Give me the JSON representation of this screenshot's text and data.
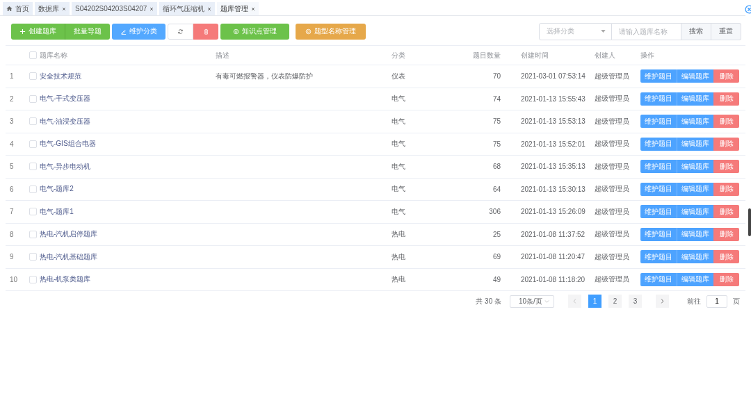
{
  "tabs": [
    {
      "label": "首页",
      "kind": "home",
      "selected": false
    },
    {
      "label": "数据库",
      "kind": "closable",
      "selected": false
    },
    {
      "label": "S04202S04203S04207",
      "kind": "closable",
      "selected": false
    },
    {
      "label": "循环气压缩机",
      "kind": "closable",
      "selected": false
    },
    {
      "label": "题库管理",
      "kind": "closable",
      "selected": true
    }
  ],
  "toolbar": {
    "groups": [
      [
        {
          "label": "创建题库",
          "kind": "create"
        },
        {
          "label": "批量导题",
          "kind": "import"
        }
      ],
      [
        {
          "label": "维护分类",
          "kind": "category"
        }
      ],
      [
        {
          "kind": "refresh"
        },
        {
          "kind": "delete"
        }
      ],
      [
        {
          "label": "知识点管理",
          "kind": "knowledge"
        }
      ],
      [
        {
          "label": "题型名称管理",
          "kind": "types"
        }
      ]
    ]
  },
  "search": {
    "category_placeholder": "选择分类",
    "name_placeholder": "请输入题库名称",
    "buttons": [
      "搜索",
      "重置"
    ]
  },
  "table": {
    "all_checked": false,
    "columns": [
      "题库名称",
      "描述",
      "分类",
      "题目数量",
      "创建时间",
      "创建人",
      "操作"
    ],
    "rows": [
      {
        "index": "1",
        "checked": false,
        "name": "安全技术规范",
        "description": "有毒可燃报警器，仪表防爆防护",
        "category": "仪表",
        "count": "70",
        "created": "2021-03-01 07:53:14",
        "creator": "超级管理员",
        "actions": [
          {
            "label": "维护题目",
            "kind": "primary"
          },
          {
            "label": "编辑题库",
            "kind": "primary"
          },
          {
            "label": "删除",
            "kind": "danger"
          }
        ]
      },
      {
        "index": "2",
        "checked": false,
        "name": "电气-干式变压器",
        "category": "电气",
        "count": "74",
        "created": "2021-01-13 15:55:43",
        "creator": "超级管理员",
        "actions": [
          {
            "label": "维护题目",
            "kind": "primary"
          },
          {
            "label": "编辑题库",
            "kind": "primary"
          },
          {
            "label": "删除",
            "kind": "danger"
          }
        ]
      },
      {
        "index": "3",
        "checked": false,
        "name": "电气-油浸变压器",
        "category": "电气",
        "count": "75",
        "created": "2021-01-13 15:53:13",
        "creator": "超级管理员",
        "actions": [
          {
            "label": "维护题目",
            "kind": "primary"
          },
          {
            "label": "编辑题库",
            "kind": "primary"
          },
          {
            "label": "删除",
            "kind": "danger"
          }
        ]
      },
      {
        "index": "4",
        "checked": false,
        "name": "电气-GIS组合电器",
        "category": "电气",
        "count": "75",
        "created": "2021-01-13 15:52:01",
        "creator": "超级管理员",
        "actions": [
          {
            "label": "维护题目",
            "kind": "primary"
          },
          {
            "label": "编辑题库",
            "kind": "primary"
          },
          {
            "label": "删除",
            "kind": "danger"
          }
        ]
      },
      {
        "index": "5",
        "checked": false,
        "name": "电气-异步电动机",
        "category": "电气",
        "count": "68",
        "created": "2021-01-13 15:35:13",
        "creator": "超级管理员",
        "actions": [
          {
            "label": "维护题目",
            "kind": "primary"
          },
          {
            "label": "编辑题库",
            "kind": "primary"
          },
          {
            "label": "删除",
            "kind": "danger"
          }
        ]
      },
      {
        "index": "6",
        "checked": false,
        "name": "电气-题库2",
        "category": "电气",
        "count": "64",
        "created": "2021-01-13 15:30:13",
        "creator": "超级管理员",
        "actions": [
          {
            "label": "维护题目",
            "kind": "primary"
          },
          {
            "label": "编辑题库",
            "kind": "primary"
          },
          {
            "label": "删除",
            "kind": "danger"
          }
        ]
      },
      {
        "index": "7",
        "checked": false,
        "name": "电气-题库1",
        "category": "电气",
        "count": "306",
        "created": "2021-01-13 15:26:09",
        "creator": "超级管理员",
        "actions": [
          {
            "label": "维护题目",
            "kind": "primary"
          },
          {
            "label": "编辑题库",
            "kind": "primary"
          },
          {
            "label": "删除",
            "kind": "danger"
          }
        ]
      },
      {
        "index": "8",
        "checked": false,
        "name": "热电-汽机启停题库",
        "category": "热电",
        "count": "25",
        "created": "2021-01-08 11:37:52",
        "creator": "超级管理员",
        "actions": [
          {
            "label": "维护题目",
            "kind": "primary"
          },
          {
            "label": "编辑题库",
            "kind": "primary"
          },
          {
            "label": "删除",
            "kind": "danger"
          }
        ]
      },
      {
        "index": "9",
        "checked": false,
        "name": "热电-汽机基础题库",
        "category": "热电",
        "count": "69",
        "created": "2021-01-08 11:20:47",
        "creator": "超级管理员",
        "actions": [
          {
            "label": "维护题目",
            "kind": "primary"
          },
          {
            "label": "编辑题库",
            "kind": "primary"
          },
          {
            "label": "删除",
            "kind": "danger"
          }
        ]
      },
      {
        "index": "10",
        "checked": false,
        "name": "热电-机泵类题库",
        "category": "热电",
        "count": "49",
        "created": "2021-01-08 11:18:20",
        "creator": "超级管理员",
        "actions": [
          {
            "label": "维护题目",
            "kind": "primary"
          },
          {
            "label": "编辑题库",
            "kind": "primary"
          },
          {
            "label": "删除",
            "kind": "danger"
          }
        ]
      }
    ]
  },
  "pagination": {
    "total": "共 30 条",
    "page_size": "10条/页",
    "pages": [
      {
        "label": "1",
        "selected": true
      },
      {
        "label": "2",
        "selected": false
      },
      {
        "label": "3",
        "selected": false
      }
    ],
    "goto_label": "前往",
    "goto_value": "1",
    "goto_suffix": "页"
  }
}
